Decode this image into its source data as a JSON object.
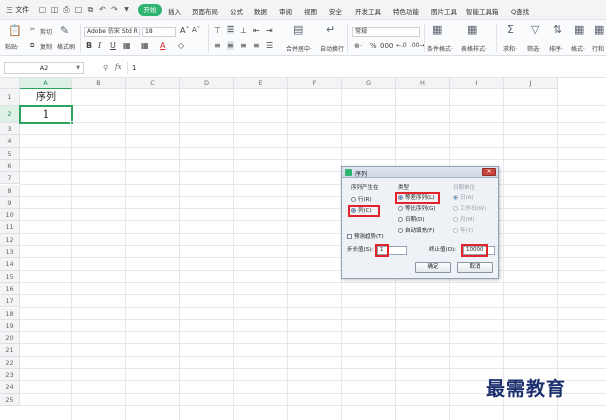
{
  "tabbar": {
    "file": "三 文件",
    "tabs": [
      "开始",
      "插入",
      "页面布局",
      "公式",
      "数据",
      "审阅",
      "视图",
      "安全",
      "开发工具",
      "特色功能",
      "图片工具",
      "智能工具箱"
    ],
    "search": "Q查找"
  },
  "ribbon": {
    "cut": "剪切",
    "paste": "粘贴·",
    "copy": "复制",
    "format_painter": "格式刷",
    "font": "Adobe 仿宋 Std R",
    "font_size": "18",
    "bold": "B",
    "italic": "I",
    "underline": "U",
    "merge": "合并居中·",
    "wrap": "自动换行",
    "number_format": "常规",
    "cond_format": "条件格式·",
    "table_style": "表格样式·",
    "sum": "求和·",
    "filter": "筛选·",
    "sort": "排序·",
    "fill": "格式·",
    "row_col": "行和"
  },
  "formula_bar": {
    "cell_ref": "A2",
    "fx": "fx",
    "value": "1"
  },
  "sheet": {
    "columns": [
      "A",
      "B",
      "C",
      "D",
      "E",
      "F",
      "G",
      "H",
      "I",
      "J"
    ],
    "rows": [
      "1",
      "2",
      "3",
      "4",
      "5",
      "6",
      "7",
      "8",
      "9",
      "10",
      "11",
      "12",
      "13",
      "14",
      "15",
      "16",
      "17",
      "18",
      "19",
      "20",
      "21",
      "22",
      "23",
      "24",
      "25"
    ],
    "a1": "序列",
    "a2": "1"
  },
  "dialog": {
    "title": "序列",
    "group_series_in": "序列产生在",
    "opt_rows": "行(R)",
    "opt_cols": "列(C)",
    "group_type": "类型",
    "opt_linear": "等差序列(L)",
    "opt_growth": "等比序列(G)",
    "opt_date": "日期(D)",
    "opt_autofill": "自动填充(F)",
    "group_date_unit": "日期单位",
    "opt_day": "日(A)",
    "opt_weekday": "工作日(W)",
    "opt_month": "月(M)",
    "opt_year": "年(Y)",
    "trend": "预测趋势(T)",
    "step_label": "步长值(S):",
    "step_value": "1",
    "stop_label": "终止值(O):",
    "stop_value": "10000",
    "ok": "确定",
    "cancel": "取消"
  },
  "watermark": "最需教育",
  "colors": {
    "accent_green": "#2db46e",
    "highlight_red": "#e3232a"
  }
}
